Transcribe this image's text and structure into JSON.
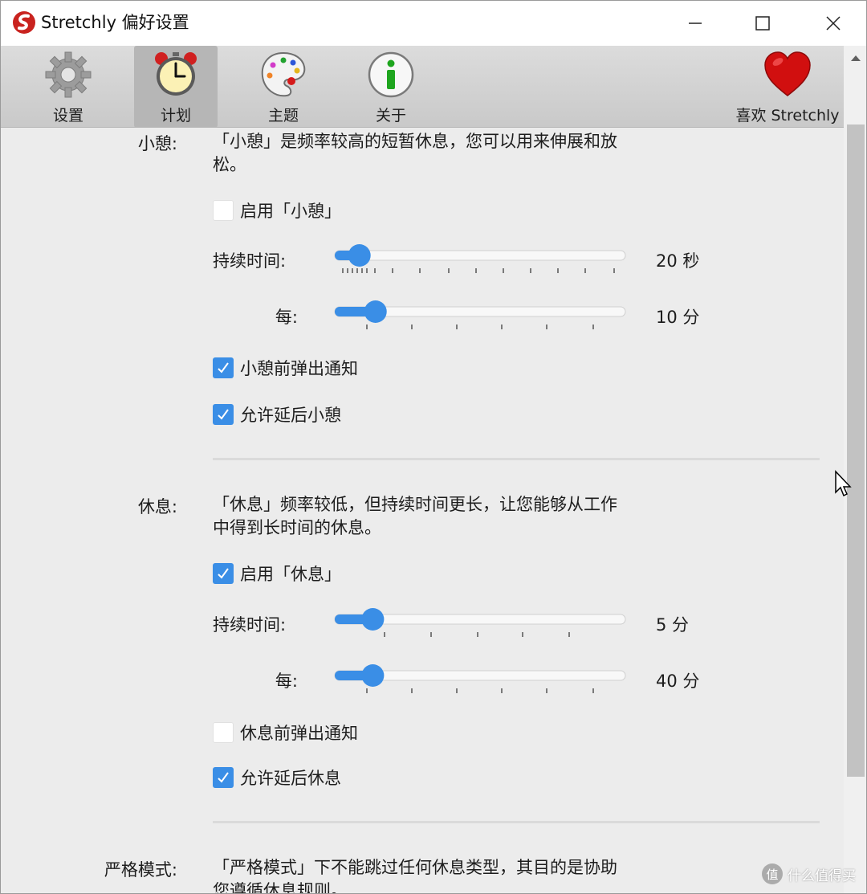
{
  "window": {
    "title": "Stretchly 偏好设置"
  },
  "toolbar": {
    "tabs": [
      {
        "label": "设置",
        "icon": "gear-icon"
      },
      {
        "label": "计划",
        "icon": "alarm-clock-icon"
      },
      {
        "label": "主题",
        "icon": "palette-icon"
      },
      {
        "label": "关于",
        "icon": "info-icon"
      }
    ],
    "love": {
      "label": "喜欢 Stretchly",
      "icon": "heart-icon"
    },
    "active_tab": "计划"
  },
  "microbreak": {
    "label": "小憩:",
    "description": "「小憩」是频率较高的短暂休息，您可以用来伸展和放松。",
    "enable_label": "启用「小憩」",
    "enable_checked": false,
    "duration_label": "持续时间:",
    "duration_value": "20 秒",
    "duration_fraction": 0.05,
    "interval_label": "每:",
    "interval_value": "10 分",
    "interval_fraction": 0.11,
    "notify_label": "小憩前弹出通知",
    "notify_checked": true,
    "postpone_label": "允许延后小憩",
    "postpone_checked": true
  },
  "break": {
    "label": "休息:",
    "description": "「休息」频率较低，但持续时间更长，让您能够从工作中得到长时间的休息。",
    "enable_label": "启用「休息」",
    "enable_checked": true,
    "duration_label": "持续时间:",
    "duration_value": "5 分",
    "duration_fraction": 0.1,
    "interval_label": "每:",
    "interval_value": "40 分",
    "interval_fraction": 0.1,
    "notify_label": "休息前弹出通知",
    "notify_checked": false,
    "postpone_label": "允许延后休息",
    "postpone_checked": true
  },
  "strict": {
    "label": "严格模式:",
    "description": "「严格模式」下不能跳过任何休息类型，其目的是协助您遵循休息规则。"
  },
  "watermark": {
    "icon": "值",
    "text": "什么值得买"
  },
  "colors": {
    "accent": "#3a8ee6",
    "toolbar": "#d2d2d2",
    "content_bg": "#ececec"
  }
}
